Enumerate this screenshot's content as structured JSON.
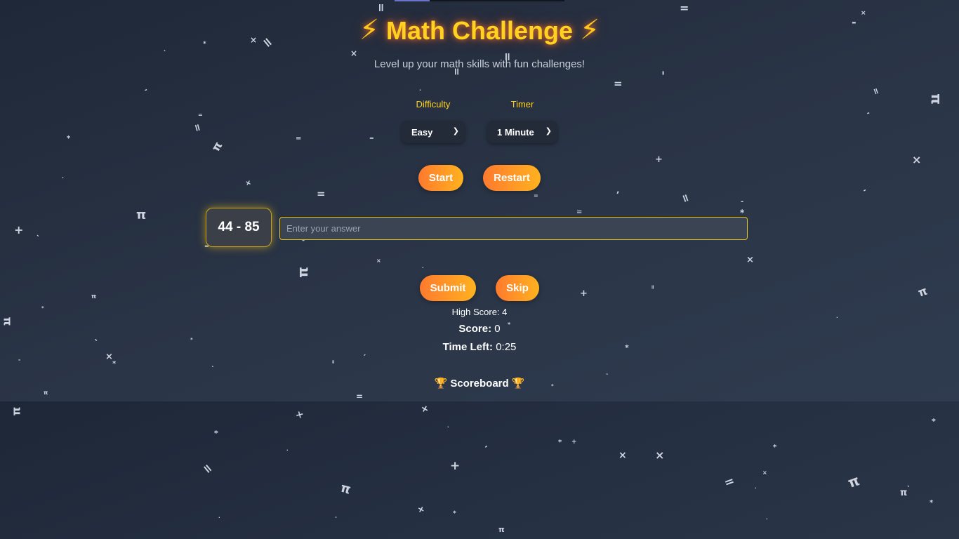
{
  "header": {
    "title": "Math Challenge",
    "subtitle": "Level up your math skills with fun challenges!",
    "bolt_icon": "⚡"
  },
  "options": {
    "difficulty_label": "Difficulty",
    "difficulty_value": "Easy",
    "timer_label": "Timer",
    "timer_value": "1 Minute"
  },
  "controls": {
    "start_label": "Start",
    "restart_label": "Restart",
    "submit_label": "Submit",
    "skip_label": "Skip"
  },
  "game": {
    "problem": "44 - 85",
    "answer_placeholder": "Enter your answer",
    "answer_value": ""
  },
  "stats": {
    "high_score_label": "High Score:",
    "high_score_value": "4",
    "score_label": "Score:",
    "score_value": "0",
    "time_left_label": "Time Left:",
    "time_left_value": "0:25"
  },
  "scoreboard": {
    "title": "Scoreboard",
    "trophy_icon": "🏆"
  },
  "colors": {
    "accent_yellow": "#ffd21f",
    "button_gradient_start": "#ff7a2e",
    "button_gradient_end": "#ffb21f",
    "background": "#243041"
  }
}
